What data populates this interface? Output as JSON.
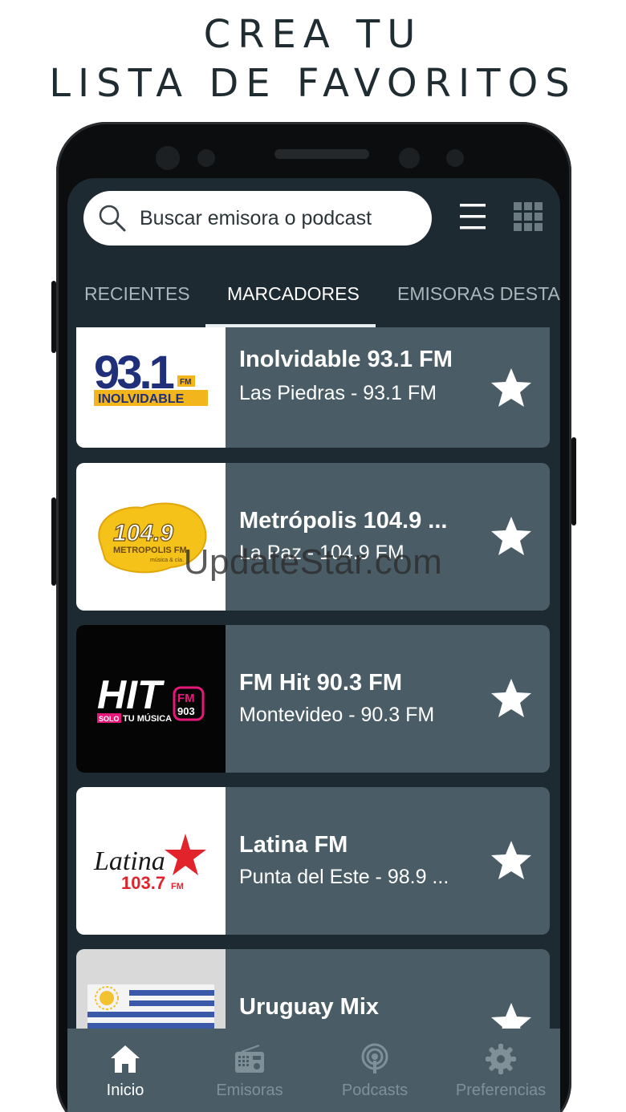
{
  "headline": {
    "line1": "CREA TU",
    "line2": "LISTA DE FAVORITOS"
  },
  "search": {
    "placeholder": "Buscar emisora o podcast"
  },
  "tabs": [
    {
      "label": "RECIENTES",
      "active": false
    },
    {
      "label": "MARCADORES",
      "active": true
    },
    {
      "label": "EMISORAS DESTACADAS",
      "active": false
    }
  ],
  "stations": [
    {
      "name": "Inolvidable 93.1 FM",
      "subtitle": "Las Piedras - 93.1 FM",
      "logo_text": "93.1 FM INOLVIDABLE",
      "favorite": true
    },
    {
      "name": "Metrópolis 104.9 ...",
      "subtitle": "La Paz - 104.9 FM",
      "logo_text": "104.9 METROPOLIS FM música & cia.",
      "favorite": true
    },
    {
      "name": "FM Hit 90.3 FM",
      "subtitle": "Montevideo - 90.3 FM",
      "logo_text": "HIT FM 903 SOLO TU MÚSICA",
      "favorite": true
    },
    {
      "name": "Latina FM",
      "subtitle": "Punta del Este - 98.9 ...",
      "logo_text": "Latina 103.7 FM",
      "favorite": true
    },
    {
      "name": "Uruguay Mix",
      "subtitle": "",
      "logo_text": "",
      "favorite": true
    }
  ],
  "bottom_nav": [
    {
      "label": "Inicio",
      "icon": "home-icon",
      "active": true
    },
    {
      "label": "Emisoras",
      "icon": "radio-icon",
      "active": false
    },
    {
      "label": "Podcasts",
      "icon": "podcast-icon",
      "active": false
    },
    {
      "label": "Preferencias",
      "icon": "gear-icon",
      "active": false
    }
  ],
  "watermark": "UpdateStar.com",
  "colors": {
    "screen_bg": "#1d2a31",
    "card_bg": "#4a5d66",
    "headline": "#1f2d33",
    "inactive_nav": "#7f9099"
  }
}
